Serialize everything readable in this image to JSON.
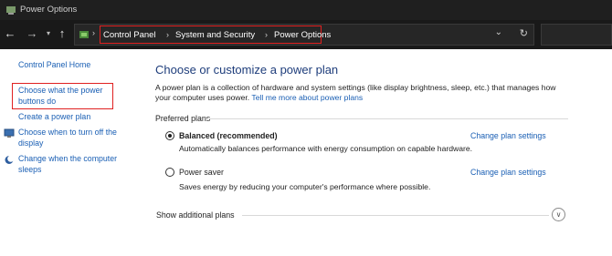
{
  "window": {
    "title": "Power Options"
  },
  "nav": {
    "back": "←",
    "forward": "→",
    "recent": "▾",
    "up": "↑"
  },
  "address": {
    "root_sep": "›",
    "crumbs": [
      "Control Panel",
      "System and Security",
      "Power Options"
    ],
    "sep": "›",
    "dropdown": "⌄",
    "refresh": "↻"
  },
  "sidebar": {
    "home": "Control Panel Home",
    "power_buttons": "Choose what the power buttons do",
    "create_plan": "Create a power plan",
    "turn_off_display": "Choose when to turn off the display",
    "sleep": "Change when the computer sleeps"
  },
  "main": {
    "heading": "Choose or customize a power plan",
    "description": "A power plan is a collection of hardware and system settings (like display brightness, sleep, etc.) that manages how your computer uses power.",
    "more_link": "Tell me more about power plans",
    "preferred_label": "Preferred plans",
    "plans": [
      {
        "name": "Balanced (recommended)",
        "desc": "Automatically balances performance with energy consumption on capable hardware.",
        "link": "Change plan settings",
        "selected": true
      },
      {
        "name": "Power saver",
        "desc": "Saves energy by reducing your computer's performance where possible.",
        "link": "Change plan settings",
        "selected": false
      }
    ],
    "additional": "Show additional plans",
    "expand_glyph": "∨"
  },
  "colors": {
    "highlight_box": "#e02020",
    "link": "#1a5fb4",
    "heading": "#1e3d7b"
  }
}
